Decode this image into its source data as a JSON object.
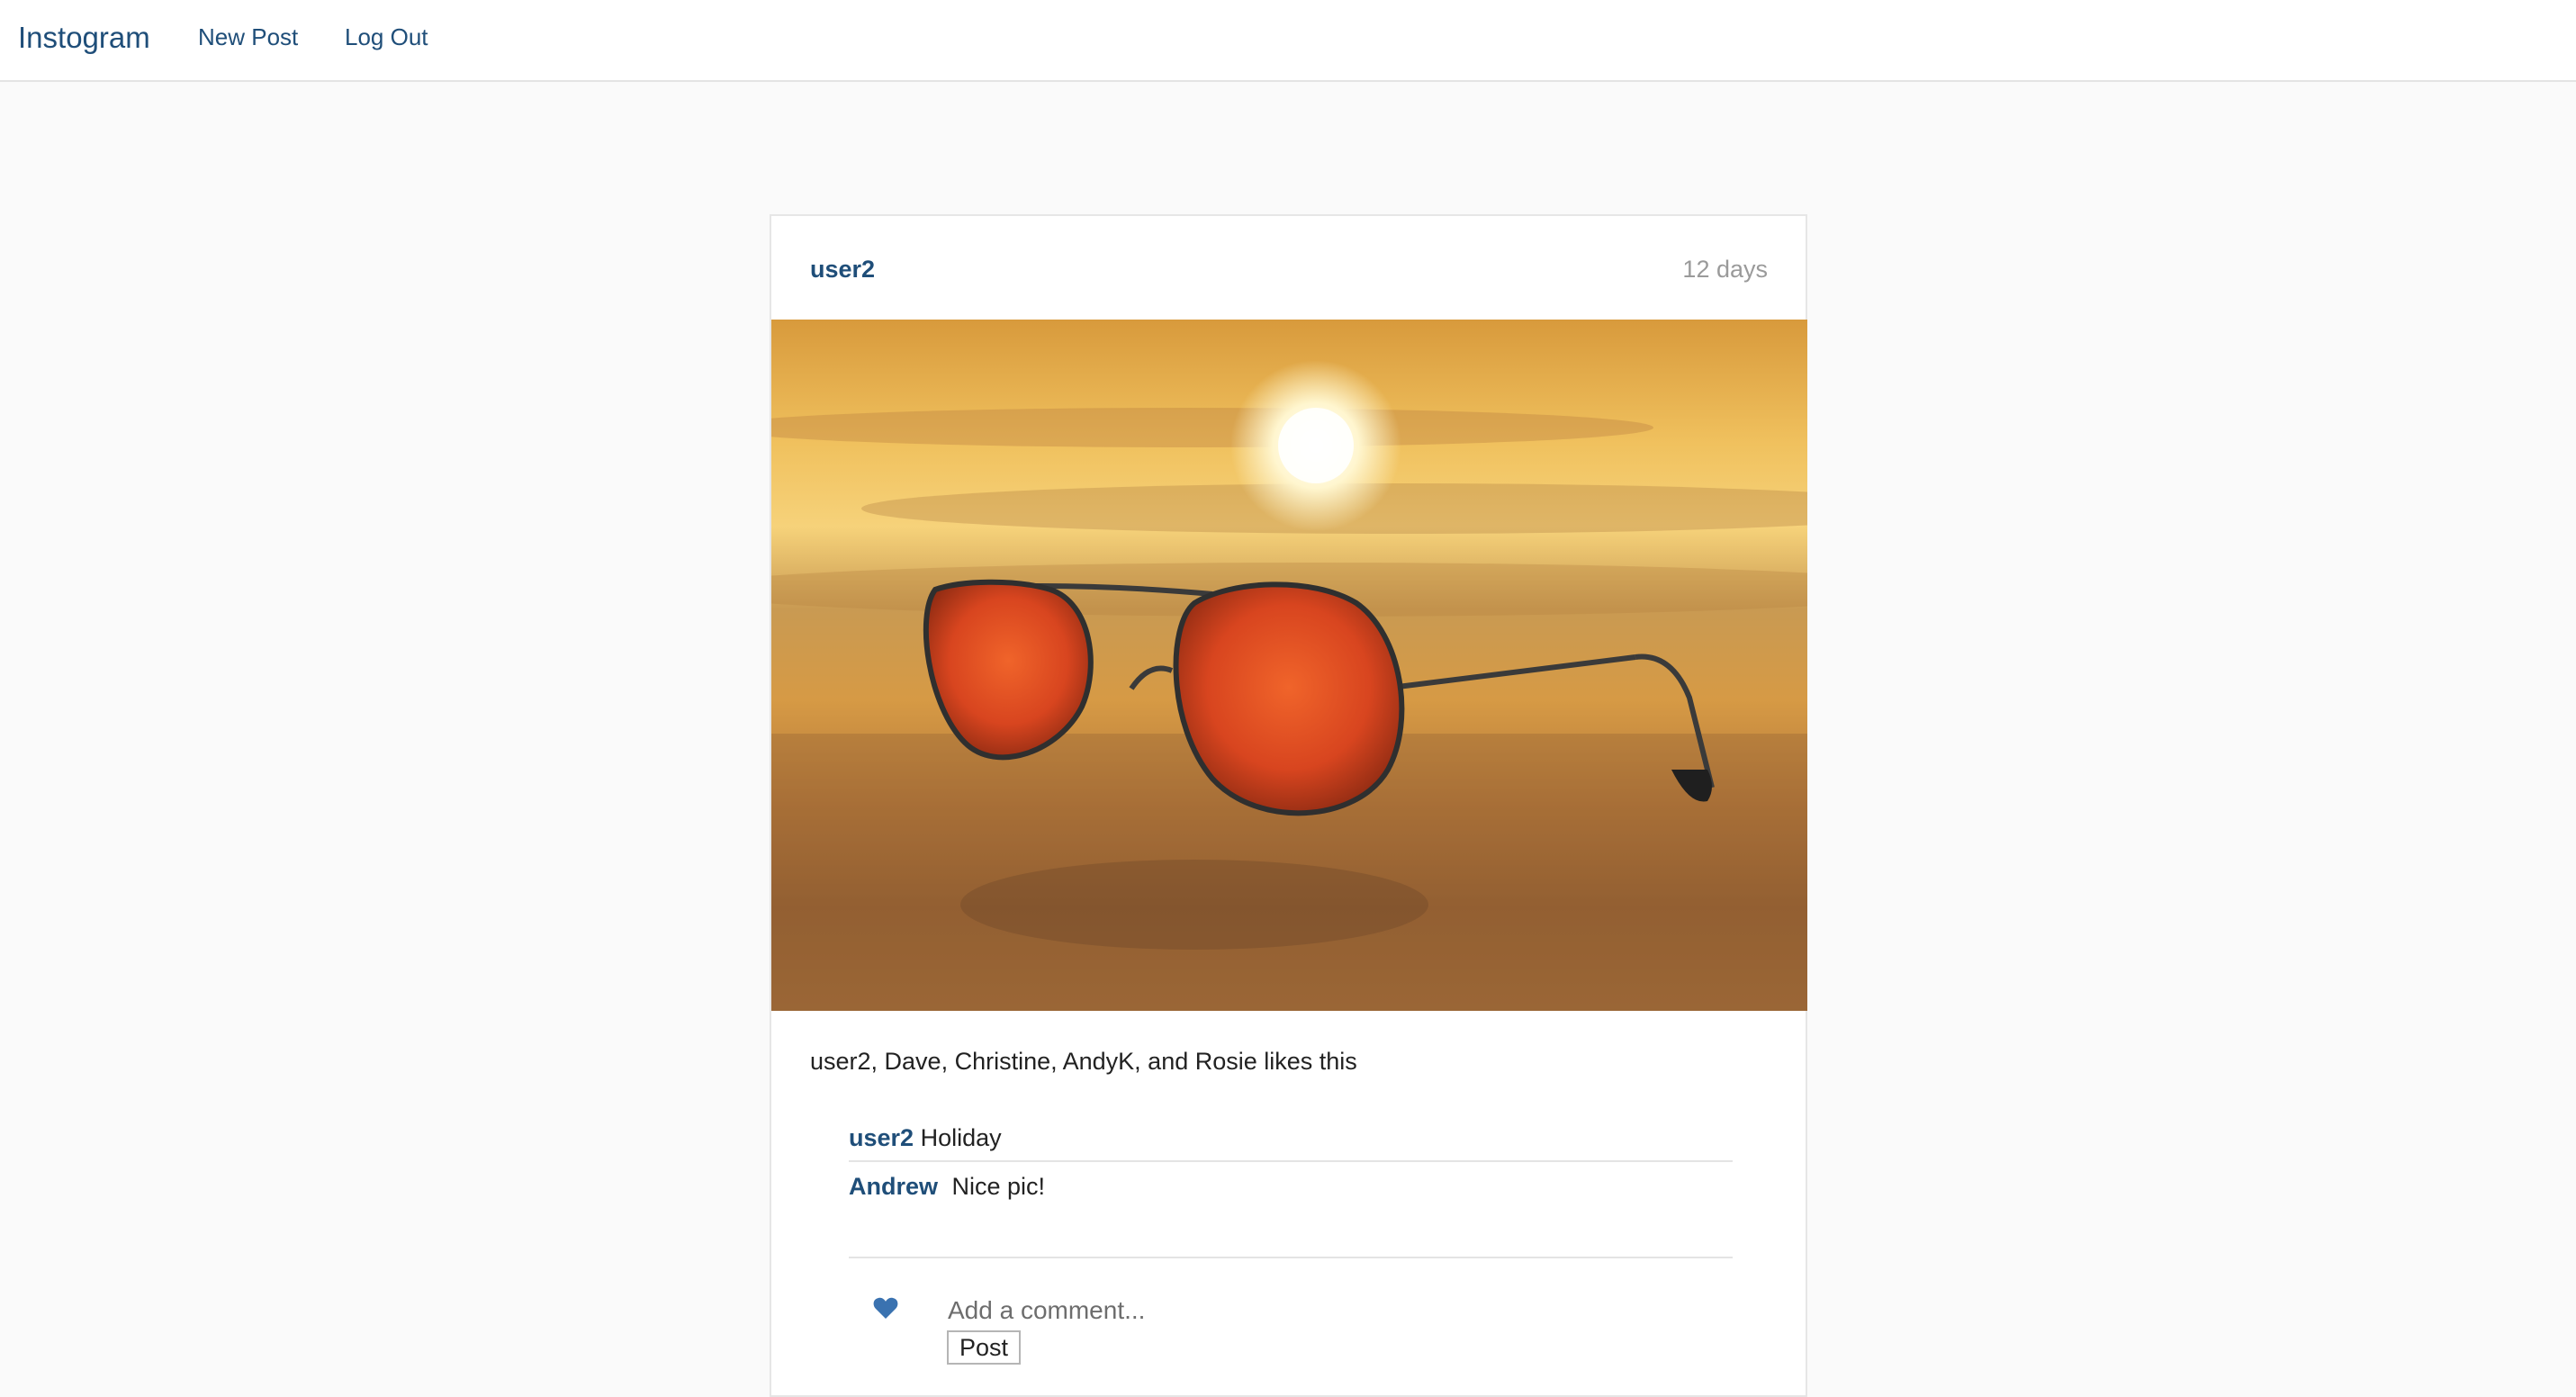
{
  "nav": {
    "brand": "Instogram",
    "new_post": "New Post",
    "log_out": "Log Out"
  },
  "post": {
    "username": "user2",
    "time_ago": "12 days",
    "likes_text": "user2, Dave, Christine, AndyK, and Rosie likes this",
    "comments": [
      {
        "author": "user2",
        "text": "Holiday"
      },
      {
        "author": "Andrew",
        "text": "Nice pic!"
      }
    ],
    "comment_placeholder": "Add a comment...",
    "post_button": "Post"
  },
  "colors": {
    "link": "#1f4e79",
    "heart": "#3a72b0",
    "muted": "#9a9a9a"
  },
  "icons": {
    "like": "heart-icon"
  }
}
